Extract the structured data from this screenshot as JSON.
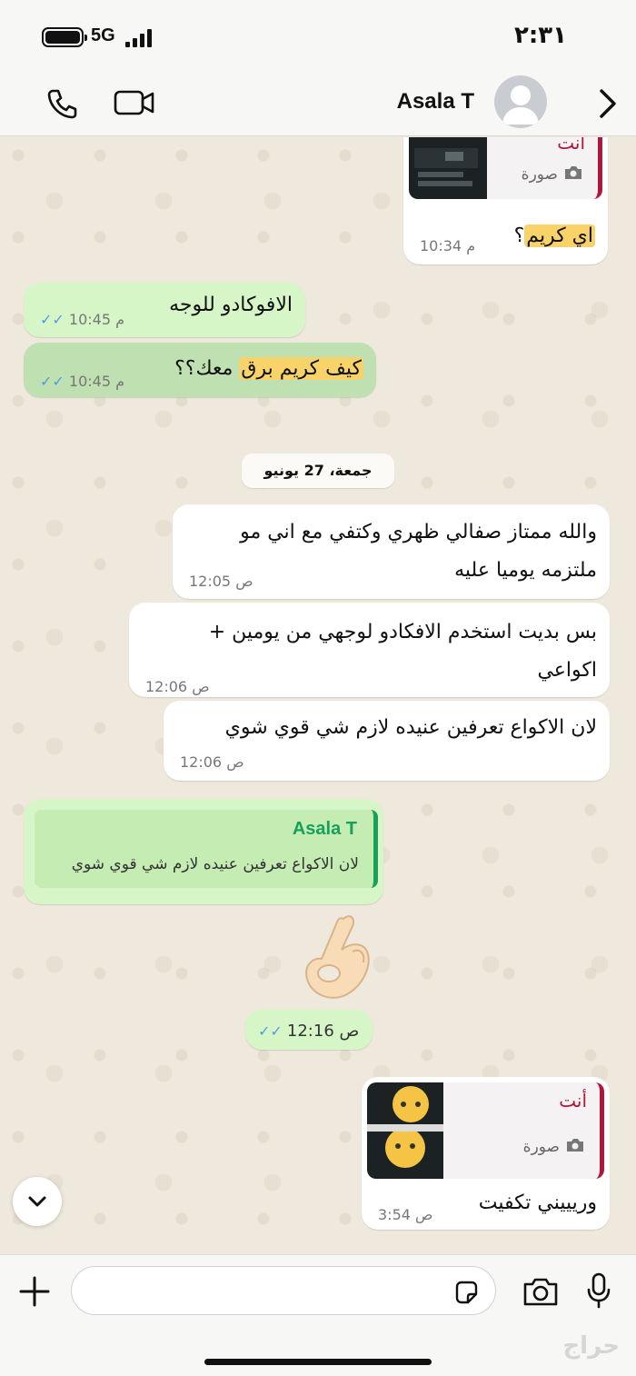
{
  "status_bar": {
    "network": "5G",
    "time": "٢:٣١",
    "battery_level": 1.0
  },
  "header": {
    "contact_name": "Asala T",
    "icons": [
      "back-chevron-icon",
      "avatar",
      "video-call-icon",
      "phone-call-icon"
    ]
  },
  "messages": [
    {
      "direction": "outgoing",
      "quote_sender": "أنت",
      "quote_kind": "صورة",
      "text_parts": [
        "اي كريم",
        "؟"
      ],
      "time": "10:34 م"
    },
    {
      "direction": "incoming",
      "text": "الافوكادو للوجه",
      "time": "10:45 م",
      "read": true
    },
    {
      "direction": "incoming",
      "text_parts": [
        "كيف كريم برق",
        " معك؟؟"
      ],
      "time": "10:45 م",
      "read": true
    },
    {
      "direction": "outgoing",
      "lines": [
        "والله ممتاز صفالي ظهري وكتفي مع اني مو",
        "ملتزمه يوميا عليه"
      ],
      "time": "12:05 ص"
    },
    {
      "direction": "outgoing",
      "lines": [
        "بس بديت استخدم الافكادو لوجهي من يومين +",
        "اكواعي"
      ],
      "time": "12:06 ص"
    },
    {
      "direction": "outgoing",
      "text": "لان الاكواع تعرفين عنيده لازم شي قوي شوي",
      "time": "12:06 ص"
    },
    {
      "direction": "incoming",
      "quote_sender": "Asala T",
      "quote_text": "لان الاكواع تعرفين عنيده لازم شي قوي شوي",
      "emoji": "👌🏻",
      "time": "12:16 ص",
      "read": true
    },
    {
      "direction": "outgoing",
      "quote_sender": "أنت",
      "quote_kind": "صورة",
      "text": "وريييني تكفيت",
      "time": "3:54 ص"
    }
  ],
  "date_separator": "جمعة، 27 يونيو",
  "input": {
    "placeholder": ""
  },
  "watermark": "حراج",
  "colors": {
    "incoming_bubble": "#d7f6c7",
    "outgoing_bubble": "#ffffff",
    "highlight": "#f7d36a",
    "read_ticks": "#4a9ee8",
    "quote_bar_self": "#b0163c",
    "quote_bar_other": "#1aa05a"
  }
}
